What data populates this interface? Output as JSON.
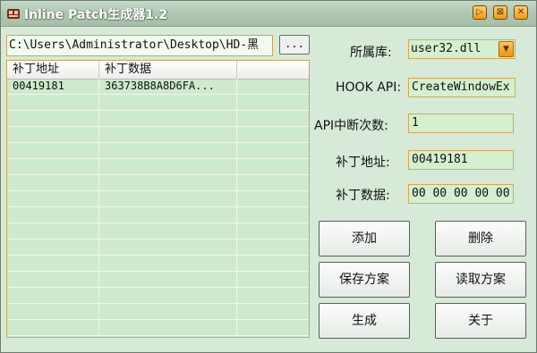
{
  "window": {
    "title": "Inline Patch生成器1.2",
    "controls": [
      "▷",
      "⊠",
      "✕"
    ]
  },
  "file": {
    "path": "C:\\Users\\Administrator\\Desktop\\HD-黑",
    "browse_label": "..."
  },
  "table": {
    "columns": [
      "补丁地址",
      "补丁数据",
      ""
    ],
    "rows": [
      [
        "00419181",
        "363738B8A8D6FA...",
        ""
      ],
      [
        "",
        "",
        ""
      ],
      [
        "",
        "",
        ""
      ],
      [
        "",
        "",
        ""
      ],
      [
        "",
        "",
        ""
      ],
      [
        "",
        "",
        ""
      ],
      [
        "",
        "",
        ""
      ],
      [
        "",
        "",
        ""
      ],
      [
        "",
        "",
        ""
      ],
      [
        "",
        "",
        ""
      ],
      [
        "",
        "",
        ""
      ],
      [
        "",
        "",
        ""
      ],
      [
        "",
        "",
        ""
      ],
      [
        "",
        "",
        ""
      ],
      [
        "",
        "",
        ""
      ],
      [
        "",
        "",
        ""
      ]
    ]
  },
  "form": {
    "library_label": "所属库:",
    "library_value": "user32.dll",
    "hook_api_label": "HOOK API:",
    "hook_api_value": "CreateWindowEx",
    "break_count_label": "API中断次数:",
    "break_count_value": "1",
    "patch_addr_label": "补丁地址:",
    "patch_addr_value": "00419181",
    "patch_data_label": "补丁数据:",
    "patch_data_value": "00 00 00 00 00"
  },
  "buttons": {
    "add": "添加",
    "delete": "删除",
    "save": "保存方案",
    "load": "读取方案",
    "generate": "生成",
    "about": "关于"
  },
  "colors": {
    "background": "#d7ead8",
    "accent": "#f39a1a",
    "field_border": "#d3a857"
  }
}
